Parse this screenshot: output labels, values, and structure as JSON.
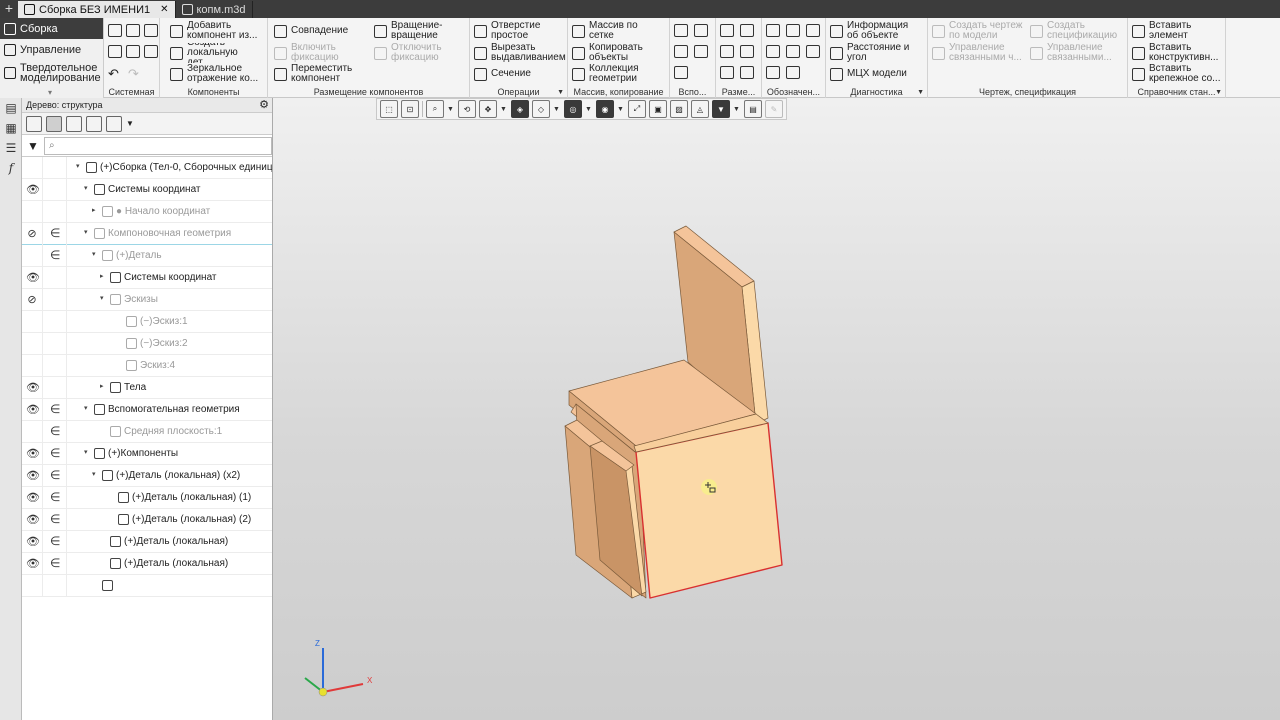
{
  "tabs": [
    {
      "label": "Сборка БЕЗ ИМЕНИ1",
      "active": true
    },
    {
      "label": "копм.m3d",
      "active": false
    }
  ],
  "modes": {
    "assembly": "Сборка",
    "management": "Управление",
    "solid": "Твердотельное моделирование"
  },
  "ribbon": {
    "groups": {
      "system": "Системная",
      "components": "Компоненты",
      "placement": "Размещение компонентов",
      "operations": "Операции",
      "array": "Массив, копирование",
      "aux": "Вспо...",
      "dims": "Разме...",
      "designations": "Обозначен...",
      "diagnostics": "Диагностика",
      "drawing": "Чертеж, спецификация",
      "reference": "Справочник стан..."
    },
    "commands": {
      "add_component": "Добавить компонент из...",
      "create_local": "Создать локальную дет...",
      "mirror": "Зеркальное отражение ко...",
      "coincidence": "Совпадение",
      "enable_fix": "Включить фиксацию",
      "move_component": "Переместить компонент",
      "rotation": "Вращение-вращение",
      "disable_fix": "Отключить фиксацию",
      "hole": "Отверстие простое",
      "cut_extrude": "Вырезать выдавливанием",
      "section": "Сечение",
      "array_grid": "Массив по сетке",
      "copy_objects": "Копировать объекты",
      "geom_collection": "Коллекция геометрии",
      "object_info": "Информация об объекте",
      "distance_angle": "Расстояние и угол",
      "mass_props": "МЦХ модели",
      "create_drawing": "Создать чертеж по модели",
      "create_spec": "Создать спецификацию",
      "manage_linked1": "Управление связанными ч...",
      "manage_linked2": "Управление связанными...",
      "insert_element": "Вставить элемент",
      "insert_construct": "Вставить конструктивн...",
      "insert_fastener": "Вставить крепежное со..."
    }
  },
  "tree": {
    "title": "Дерево: структура",
    "search_placeholder": "⌕",
    "rows": [
      {
        "label": "(+)Сборка (Тел-0, Сборочных единиц",
        "eye": "",
        "inc": "",
        "twisty": "▾"
      },
      {
        "label": "Системы координат",
        "eye": "👁",
        "inc": "",
        "twisty": "▾"
      },
      {
        "label": "● Начало координат",
        "eye": "",
        "inc": "",
        "twisty": "▸"
      },
      {
        "label": "Компоновочная геометрия",
        "eye": "⊘",
        "inc": "∈",
        "twisty": "▾"
      },
      {
        "label": "(+)Деталь",
        "eye": "",
        "inc": "∈",
        "twisty": "▾"
      },
      {
        "label": "Системы координат",
        "eye": "👁",
        "inc": "",
        "twisty": "▸"
      },
      {
        "label": "Эскизы",
        "eye": "⊘",
        "inc": "",
        "twisty": "▾"
      },
      {
        "label": "(−)Эскиз:1",
        "eye": "",
        "inc": "",
        "twisty": ""
      },
      {
        "label": "(−)Эскиз:2",
        "eye": "",
        "inc": "",
        "twisty": ""
      },
      {
        "label": "Эскиз:4",
        "eye": "",
        "inc": "",
        "twisty": ""
      },
      {
        "label": "Тела",
        "eye": "👁",
        "inc": "",
        "twisty": "▸"
      },
      {
        "label": "Вспомогательная геометрия",
        "eye": "👁",
        "inc": "∈",
        "twisty": "▾"
      },
      {
        "label": "Средняя плоскость:1",
        "eye": "",
        "inc": "∈",
        "twisty": ""
      },
      {
        "label": "(+)Компоненты",
        "eye": "👁",
        "inc": "∈",
        "twisty": "▾"
      },
      {
        "label": "(+)Деталь (локальная) (x2)",
        "eye": "👁",
        "inc": "∈",
        "twisty": "▾"
      },
      {
        "label": "(+)Деталь (локальная) (1)",
        "eye": "👁",
        "inc": "∈",
        "twisty": ""
      },
      {
        "label": "(+)Деталь (локальная) (2)",
        "eye": "👁",
        "inc": "∈",
        "twisty": ""
      },
      {
        "label": "(+)Деталь (локальная)",
        "eye": "👁",
        "inc": "∈",
        "twisty": ""
      },
      {
        "label": "(+)Деталь (локальная)",
        "eye": "👁",
        "inc": "∈",
        "twisty": ""
      },
      {
        "label": "",
        "eye": "",
        "inc": "",
        "twisty": ""
      }
    ]
  },
  "triad": {
    "z": "Z",
    "x": "X"
  },
  "colors": {
    "part_top": "#f4c49a",
    "part_front": "#fbd9a8",
    "part_side": "#d9a679",
    "edge_highlight": "#d93030",
    "tab_bar": "#3c3c3c"
  }
}
